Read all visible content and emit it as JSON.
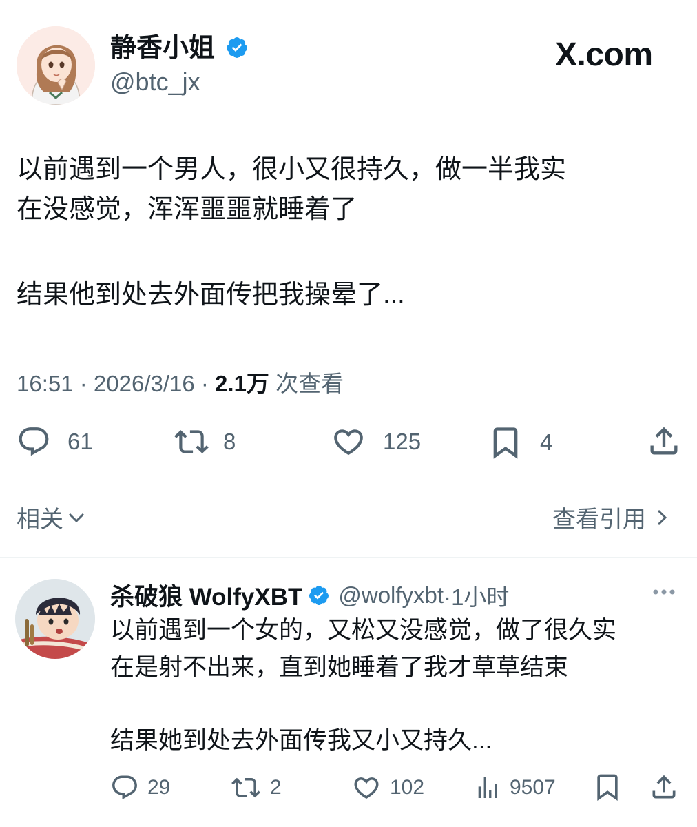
{
  "brand": {
    "logo_text": "X.com"
  },
  "main_tweet": {
    "author_name": "静香小姐",
    "author_handle": "@btc_jx",
    "text_line_1": "以前遇到一个男人，很小又很持久，做一半我实",
    "text_line_2": "在没感觉，浑浑噩噩就睡着了",
    "text_line_3": "结果他到处去外面传把我操晕了...",
    "time": "16:51 · 2026/3/16 · ",
    "views_count": "2.1万",
    "views_label": " 次查看",
    "actions": {
      "replies": "61",
      "retweets": "8",
      "likes": "125",
      "bookmarks": "4"
    }
  },
  "related": {
    "label": "相关",
    "quotes_link": "查看引用"
  },
  "reply_tweet": {
    "author_name": "杀破狼 WolfyXBT",
    "author_handle": "@wolfyxbt",
    "time": "·1小时",
    "text_line_1": "以前遇到一个女的，又松又没感觉，做了很久实",
    "text_line_2": "在是射不出来，直到她睡着了我才草草结束",
    "text_line_3": "结果她到处去外面传我又小又持久...",
    "actions": {
      "replies": "29",
      "retweets": "2",
      "likes": "102",
      "views": "9507"
    }
  },
  "colors": {
    "verified_blue": "#1d9bf0",
    "text_primary": "#0f1419",
    "text_secondary": "#536471",
    "divider": "#eff3f4"
  }
}
